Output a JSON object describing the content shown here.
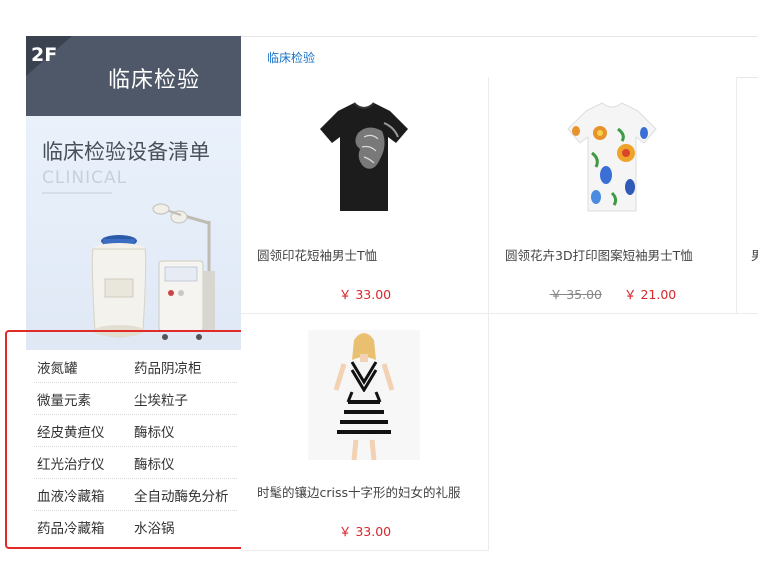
{
  "floor": {
    "number": "2F",
    "name": "临床检验"
  },
  "banner": {
    "title": "临床检验设备清单",
    "subtitle": "CLINICAL",
    "image": "lab-equipment-illustration"
  },
  "category_links": [
    [
      "液氮罐",
      "药品阴凉柜"
    ],
    [
      "微量元素",
      "尘埃粒子"
    ],
    [
      "经皮黄疸仪",
      "酶标仪"
    ],
    [
      "红光治疗仪",
      "酶标仪"
    ],
    [
      "血液冷藏箱",
      "全自动酶免分析"
    ],
    [
      "药品冷藏箱",
      "水浴锅"
    ]
  ],
  "tabs": [
    {
      "label": "临床检验",
      "active": true
    }
  ],
  "products": [
    {
      "title": "圆领印花短袖男士T恤",
      "price": "￥ 33.00",
      "old_price": "",
      "image": "black-lion-tshirt"
    },
    {
      "title": "圆领花卉3D打印图案短袖男士T恤",
      "price": "￥ 21.00",
      "old_price": "￥ 35.00",
      "image": "floral-print-tshirt"
    },
    {
      "title": "时髦的镶边criss十字形的妇女的礼服",
      "price": "￥ 33.00",
      "old_price": "",
      "image": "striped-dress"
    }
  ],
  "partial_card_text": "男",
  "colors": {
    "header_bg": "#4e5868",
    "accent_link": "#1a73c9",
    "price": "#d7272b",
    "highlight_border": "#e02b27"
  }
}
